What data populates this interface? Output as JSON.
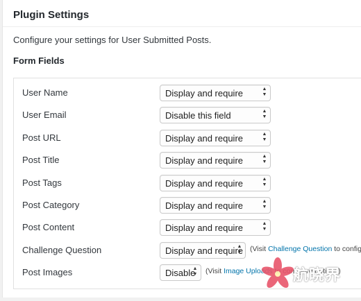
{
  "header": {
    "title": "Plugin Settings",
    "intro": "Configure your settings for User Submitted Posts."
  },
  "section": {
    "title": "Form Fields"
  },
  "fields": [
    {
      "label": "User Name",
      "value": "Display and require"
    },
    {
      "label": "User Email",
      "value": "Disable this field"
    },
    {
      "label": "Post URL",
      "value": "Display and require"
    },
    {
      "label": "Post Title",
      "value": "Display and require"
    },
    {
      "label": "Post Tags",
      "value": "Display and require"
    },
    {
      "label": "Post Category",
      "value": "Display and require"
    },
    {
      "label": "Post Content",
      "value": "Display and require"
    },
    {
      "label": "Challenge Question",
      "value": "Display and require",
      "note_prefix": "(Visit ",
      "note_link": "Challenge Question",
      "note_suffix": " to configure"
    },
    {
      "label": "Post Images",
      "value": "Disable",
      "note_prefix": "(Visit ",
      "note_link": "Image Uploads",
      "note_suffix": " to configure options)"
    }
  ],
  "watermark": {
    "text": "航晓界"
  },
  "colors": {
    "link": "#0073aa",
    "watermark_flower": "#e8566b"
  }
}
